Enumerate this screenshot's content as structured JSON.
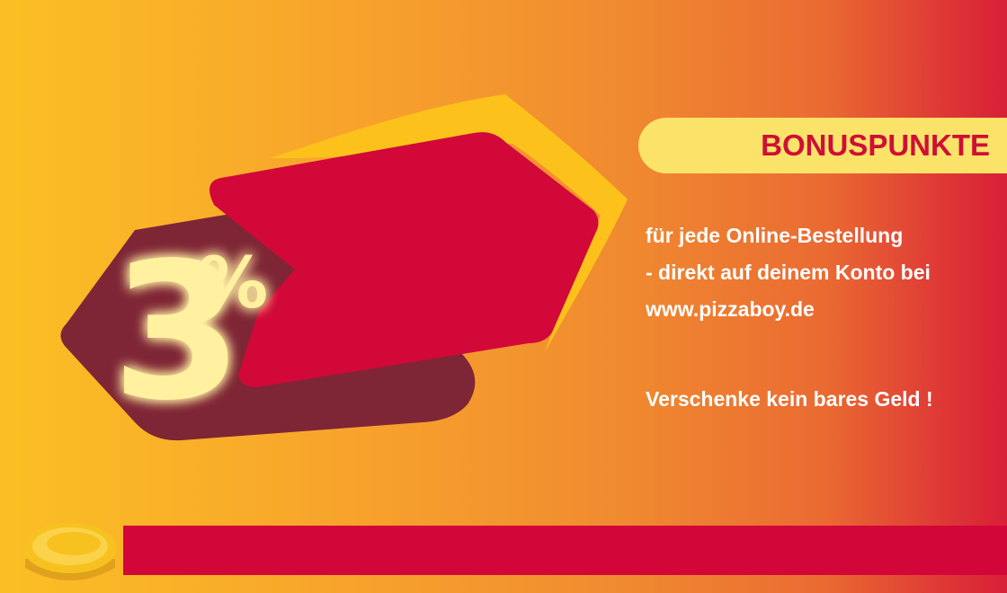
{
  "badge": {
    "value": "3",
    "unit": "%"
  },
  "header": {
    "label": "BONUSPUNKTE"
  },
  "body": {
    "lines": [
      "für jede Online-Bestellung",
      "- direkt auf deinem Konto bei",
      "www.pizzaboy.de"
    ],
    "slogan": "Verschenke kein bares Geld !"
  },
  "colors": {
    "brand_red": "#d3063a",
    "pill_yellow": "#fbe36a",
    "badge_dark": "#7e2636",
    "number_glow": "#fff1a0",
    "coin_gold": "#f7c21f"
  },
  "icons": [
    "coin-icon",
    "arrow-tag-icon"
  ]
}
